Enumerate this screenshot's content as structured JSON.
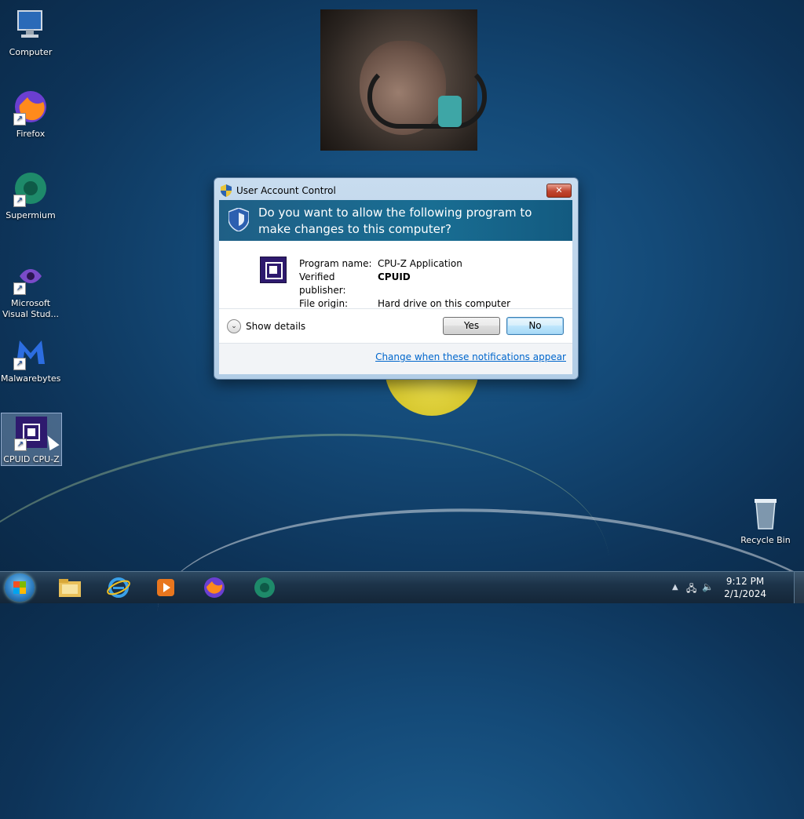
{
  "desktop": {
    "icons": [
      {
        "label": "Computer"
      },
      {
        "label": "Firefox"
      },
      {
        "label": "Supermium"
      },
      {
        "label": "Microsoft Visual Stud..."
      },
      {
        "label": "Malwarebytes"
      },
      {
        "label": "CPUID CPU-Z"
      },
      {
        "label": "Recycle Bin"
      }
    ]
  },
  "dialog": {
    "title": "User Account Control",
    "close_label": "✕",
    "question": "Do you want to allow the following program to make changes to this computer?",
    "program_name_label": "Program name:",
    "program_name": "CPU-Z Application",
    "publisher_label": "Verified publisher:",
    "publisher": "CPUID",
    "origin_label": "File origin:",
    "origin": "Hard drive on this computer",
    "show_details": "Show details",
    "yes_label": "Yes",
    "no_label": "No",
    "notifications_link": "Change when these notifications appear"
  },
  "taskbar": {
    "pinned": [
      {
        "icon": "file-explorer-icon"
      },
      {
        "icon": "internet-explorer-icon"
      },
      {
        "icon": "media-player-icon"
      },
      {
        "icon": "firefox-icon"
      },
      {
        "icon": "supermium-icon"
      }
    ],
    "time": "9:12 PM",
    "date": "2/1/2024"
  },
  "colors": {
    "banner": "#1f5f86",
    "link": "#0066cc",
    "desktop": "#144a78"
  }
}
